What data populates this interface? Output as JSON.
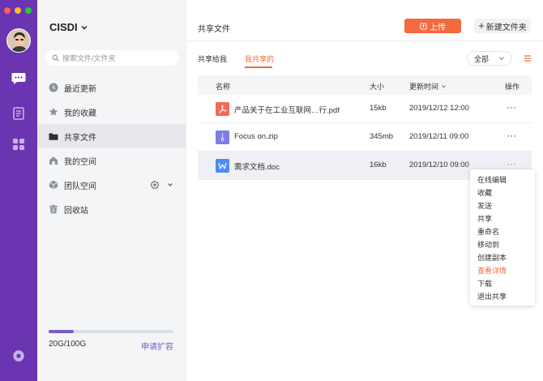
{
  "sidebar": {
    "org_name": "CISDI",
    "search_placeholder": "搜索文件/文件夹",
    "items": [
      {
        "label": "最近更新"
      },
      {
        "label": "我的收藏"
      },
      {
        "label": "共享文件"
      },
      {
        "label": "我的空间"
      },
      {
        "label": "团队空间"
      },
      {
        "label": "回收站"
      }
    ],
    "storage": {
      "used_text": "20G/100G",
      "used_fraction": 0.2,
      "expand_label": "申请扩容"
    }
  },
  "header": {
    "title": "共享文件",
    "upload_label": "上传",
    "new_folder_label": "新建文件夹"
  },
  "tabs": [
    {
      "label": "共享给我"
    },
    {
      "label": "我共享的"
    }
  ],
  "filter": {
    "selected": "全部"
  },
  "table": {
    "headers": {
      "name": "名称",
      "size": "大小",
      "updated": "更新时间",
      "actions": "操作"
    },
    "rows": [
      {
        "name": "产品关于在工业互联网…行.pdf",
        "size": "15kb",
        "updated": "2019/12/12 12:00",
        "type": "pdf",
        "more": "···"
      },
      {
        "name": "Focus on.zip",
        "size": "345mb",
        "updated": "2019/12/11  09:00",
        "type": "zip",
        "more": "···"
      },
      {
        "name": "需求文档.doc",
        "size": "16kb",
        "updated": "2019/12/10  09:00",
        "type": "doc",
        "more": "···"
      }
    ]
  },
  "context_menu": {
    "items": [
      {
        "label": "在线编辑"
      },
      {
        "label": "收藏"
      },
      {
        "label": "发送"
      },
      {
        "label": "共享"
      },
      {
        "label": "重命名"
      },
      {
        "label": "移动到"
      },
      {
        "label": "创建副本"
      },
      {
        "label": "查看详情"
      },
      {
        "label": "下载"
      },
      {
        "label": "退出共享"
      }
    ]
  },
  "colors": {
    "rail": "#6b34b0",
    "accent": "#f5693f",
    "link": "#7b5cc9",
    "pdf": "#f06a57",
    "zip": "#7a7ee6",
    "doc": "#4d8ef0"
  },
  "icons": {
    "rail": [
      "chat-icon",
      "document-icon",
      "apps-icon",
      "settings-icon"
    ],
    "sidebar": [
      "clock-icon",
      "star-icon",
      "folder-icon",
      "home-icon",
      "cube-icon",
      "trash-icon"
    ]
  }
}
